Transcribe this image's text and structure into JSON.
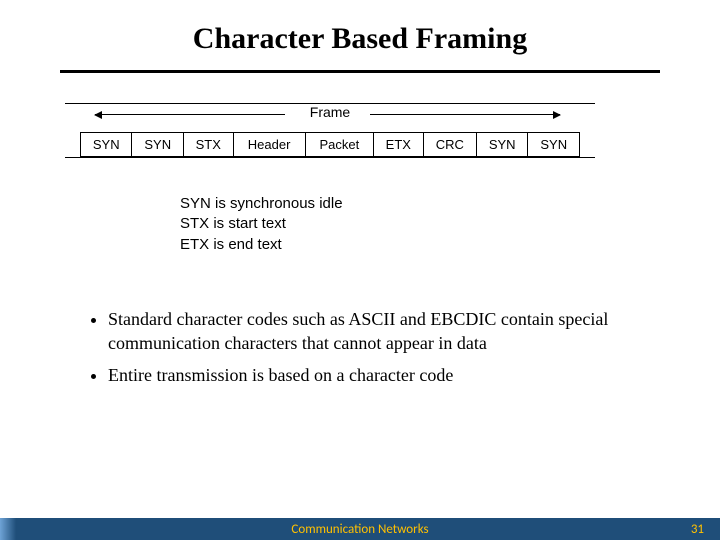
{
  "title": "Character Based Framing",
  "diagram": {
    "frame_label": "Frame",
    "cells": [
      "SYN",
      "SYN",
      "STX",
      "Header",
      "Packet",
      "ETX",
      "CRC",
      "SYN",
      "SYN"
    ]
  },
  "legend": {
    "l0": "SYN is synchronous idle",
    "l1": "STX is start text",
    "l2": "ETX is end text"
  },
  "bullets": {
    "b0": "Standard character codes such as ASCII and EBCDIC contain special communication characters that cannot appear in data",
    "b1": "Entire transmission is based on a character code"
  },
  "footer": {
    "title": "Communication Networks",
    "page": "31"
  }
}
